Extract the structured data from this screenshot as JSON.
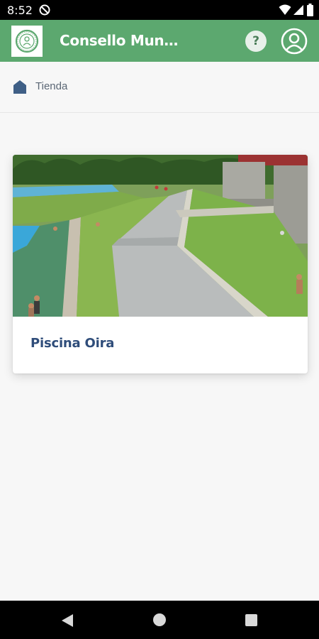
{
  "status_bar": {
    "time": "8:52",
    "icons": [
      "do-not-disturb-icon",
      "wifi-icon",
      "cell-signal-icon",
      "battery-icon"
    ]
  },
  "app_bar": {
    "title": "Consello Municipal de Deportes",
    "logo_icon": "municipal-seal-logo",
    "help_label": "?",
    "profile_icon": "account-circle-icon",
    "color": "#5ca86f"
  },
  "breadcrumb": {
    "icon": "home-icon",
    "label": "Tienda"
  },
  "cards": [
    {
      "title": "Piscina Oira",
      "image": "outdoor-swimming-pool-photo"
    }
  ],
  "nav_bar": {
    "icons": [
      "back-icon",
      "home-circle-icon",
      "recents-icon"
    ]
  },
  "colors": {
    "accent": "#5ca86f",
    "card_title": "#2f4d7a",
    "breadcrumb_text": "#5b6775",
    "background": "#f7f7f7"
  }
}
